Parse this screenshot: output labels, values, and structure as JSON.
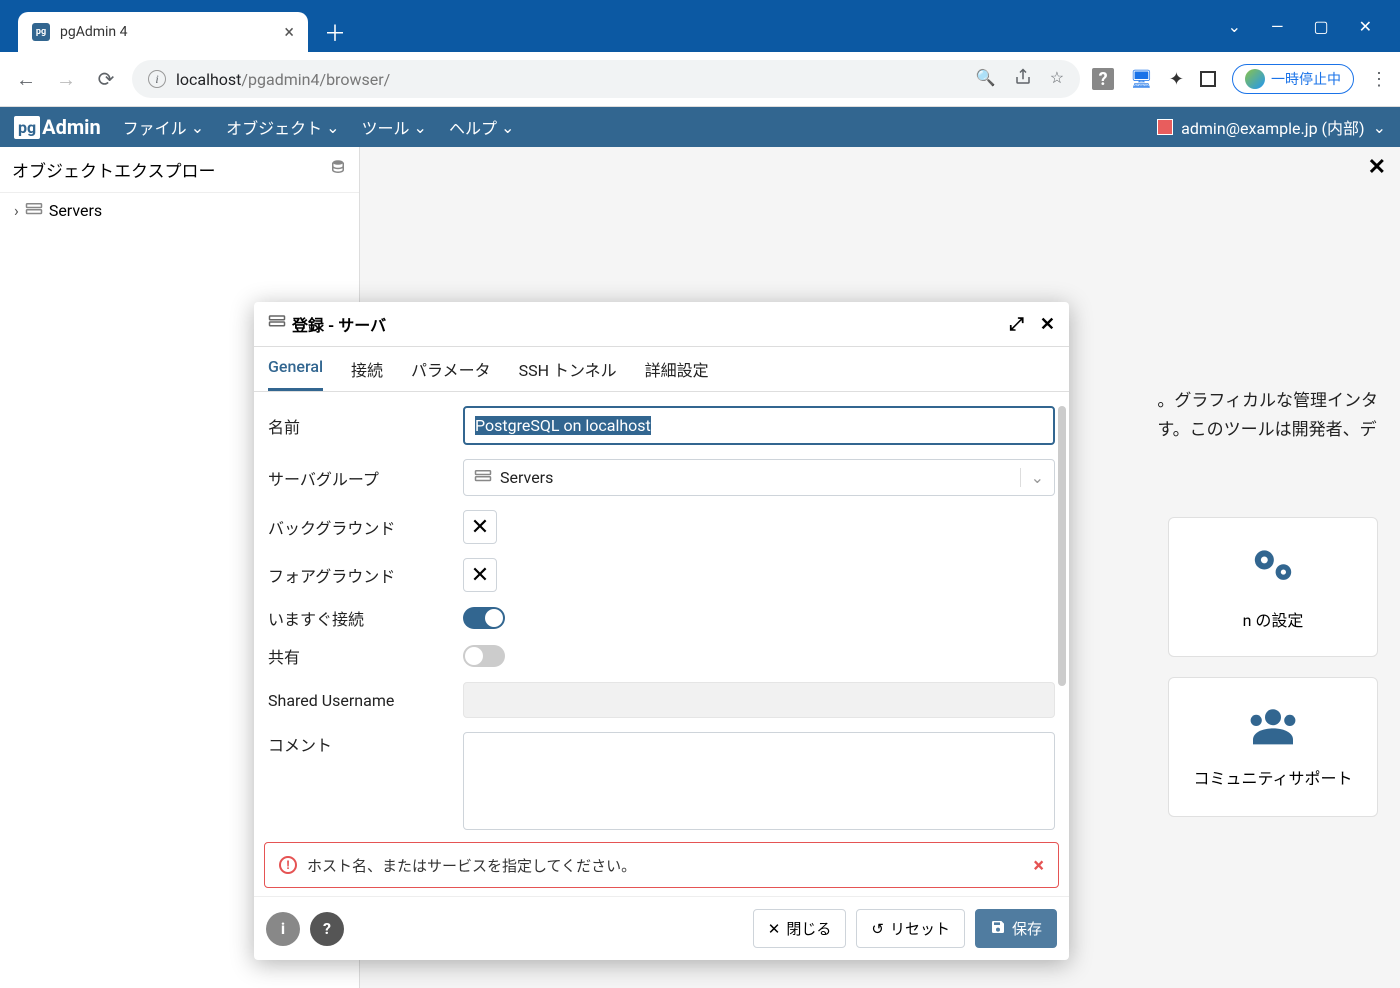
{
  "browser": {
    "tab_title": "pgAdmin 4",
    "url_host": "localhost",
    "url_path": "/pgadmin4/browser/",
    "pause_label": "一時停止中"
  },
  "pgadmin_menu": {
    "file": "ファイル",
    "object": "オブジェクト",
    "tool": "ツール",
    "help": "ヘルプ",
    "user": "admin@example.jp (内部)"
  },
  "sidebar": {
    "title": "オブジェクトエクスプロー",
    "tree_root": "Servers"
  },
  "background": {
    "line1": "。グラフィカルな管理インタ",
    "line2": "す。このツールは開発者、デ",
    "card1_label": "n の設定",
    "card2_label": "コミュニティサポート"
  },
  "dialog": {
    "title": "登録 - サーバ",
    "tabs": {
      "general": "General",
      "connection": "接続",
      "parameters": "パラメータ",
      "ssh": "SSH トンネル",
      "advanced": "詳細設定"
    },
    "fields": {
      "name_label": "名前",
      "name_value": "PostgreSQL on localhost",
      "group_label": "サーバグループ",
      "group_value": "Servers",
      "background_label": "バックグラウンド",
      "foreground_label": "フォアグラウンド",
      "connect_now_label": "いますぐ接続",
      "shared_label": "共有",
      "shared_username_label": "Shared Username",
      "comment_label": "コメント"
    },
    "error": "ホスト名、またはサービスを指定してください。",
    "footer": {
      "close": "閉じる",
      "reset": "リセット",
      "save": "保存"
    }
  }
}
